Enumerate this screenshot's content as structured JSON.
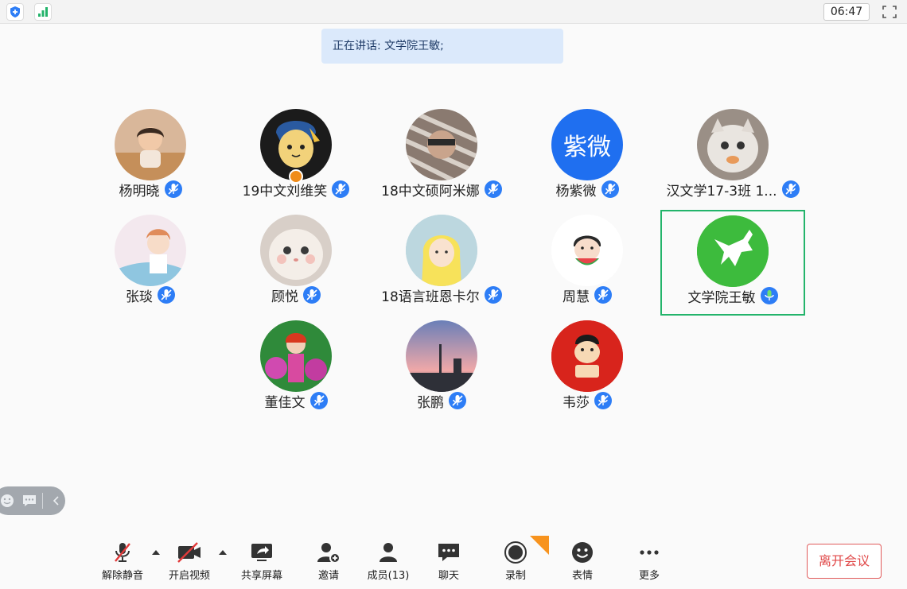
{
  "topbar": {
    "timer": "06:47"
  },
  "speaking": {
    "text": "正在讲话: 文学院王敏;"
  },
  "participants": [
    {
      "name": "杨明晓"
    },
    {
      "name": "19中文刘维笑"
    },
    {
      "name": "18中文硕阿米娜"
    },
    {
      "name": "杨紫微",
      "avatar_text": "紫微",
      "avatar_color": "#1f6ff0"
    },
    {
      "name": "汉文学17-3班 1..."
    },
    {
      "name": "张琰"
    },
    {
      "name": "顾悦"
    },
    {
      "name": "18语言班恩卡尔"
    },
    {
      "name": "周慧"
    },
    {
      "name": "文学院王敏",
      "active": true
    },
    {
      "name": "董佳文"
    },
    {
      "name": "张鹏"
    },
    {
      "name": "韦莎"
    }
  ],
  "toolbar": {
    "mute": "解除静音",
    "video": "开启视频",
    "share": "共享屏幕",
    "invite": "邀请",
    "members": "成员(13)",
    "chat": "聊天",
    "record": "录制",
    "emoji": "表情",
    "more": "更多",
    "leave": "离开会议"
  },
  "colors": {
    "accent": "#2d7df6",
    "active_border": "#23b46b",
    "leave": "#e04848",
    "banner": "#dbe9fb"
  }
}
